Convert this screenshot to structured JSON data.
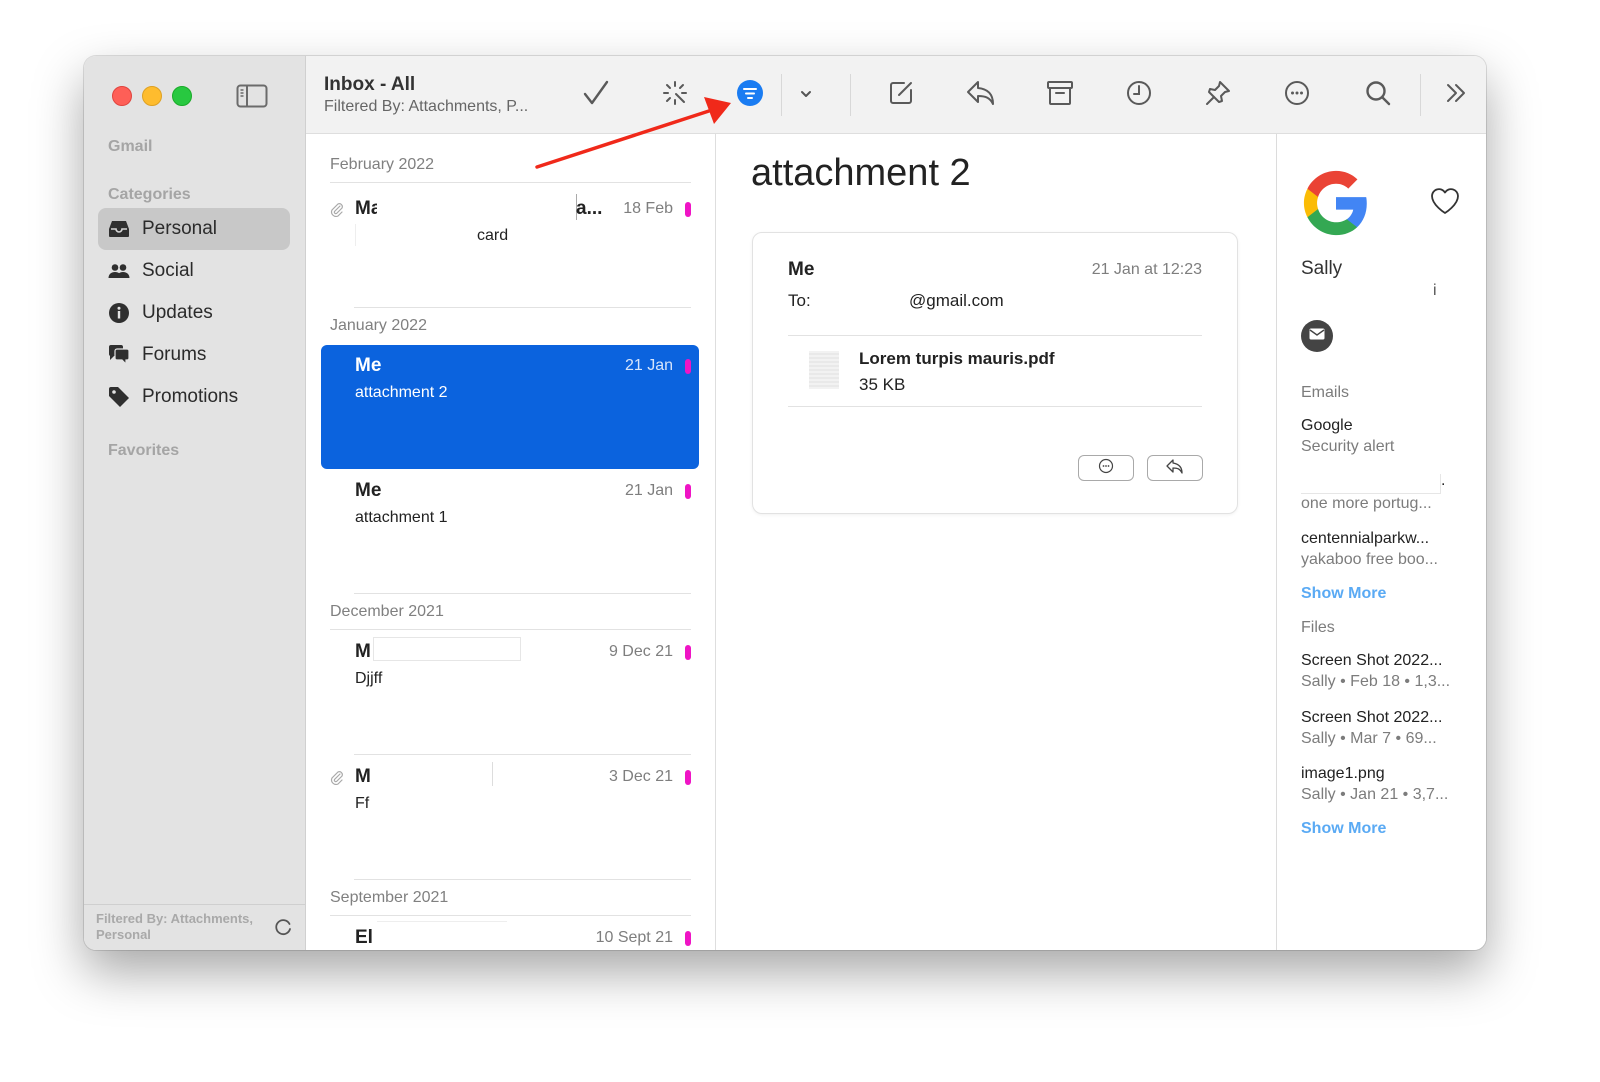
{
  "window": {
    "title": "Inbox - All",
    "subtitle": "Filtered By: Attachments, P..."
  },
  "sidebar": {
    "account": "Gmail",
    "categories_label": "Categories",
    "items": [
      {
        "label": "Personal",
        "icon": "tray-icon",
        "active": true
      },
      {
        "label": "Social",
        "icon": "people-icon",
        "active": false
      },
      {
        "label": "Updates",
        "icon": "info-icon",
        "active": false
      },
      {
        "label": "Forums",
        "icon": "chat-bubbles-icon",
        "active": false
      },
      {
        "label": "Promotions",
        "icon": "tag-icon",
        "active": false
      }
    ],
    "favorites_label": "Favorites",
    "footer_text": "Filtered By: Attachments, Personal"
  },
  "toolbar": {
    "buttons": [
      "checkmark-icon",
      "magic-wand-icon",
      "filter-icon",
      "chevron-down-icon",
      "compose-icon",
      "reply-icon",
      "archive-icon",
      "clock-icon",
      "pin-icon",
      "more-icon",
      "search-icon",
      "chevrons-right-icon"
    ],
    "filter_color": "#1a7cf2"
  },
  "list": {
    "groups": [
      {
        "month": "February 2022",
        "messages": [
          {
            "sender": "Ma",
            "sender_tail": "a...",
            "date": "18 Feb",
            "subject": "card",
            "attachment": true,
            "selected": false
          }
        ]
      },
      {
        "month": "January 2022",
        "messages": [
          {
            "sender": "Me",
            "date": "21 Jan",
            "subject": "attachment 2",
            "attachment": false,
            "selected": true
          },
          {
            "sender": "Me",
            "date": "21 Jan",
            "subject": "attachment 1",
            "attachment": false,
            "selected": false
          }
        ]
      },
      {
        "month": "December 2021",
        "messages": [
          {
            "sender": "M",
            "date": "9 Dec 21",
            "subject": "Djjff",
            "attachment": false,
            "selected": false
          },
          {
            "sender": "M",
            "date": "3 Dec 21",
            "subject": "Ff",
            "attachment": true,
            "selected": false
          }
        ]
      },
      {
        "month": "September 2021",
        "messages": [
          {
            "sender": "El",
            "date": "10 Sept 21",
            "subject": "",
            "attachment": false,
            "selected": false
          }
        ]
      }
    ],
    "flag_color": "#ef14c5",
    "selected_color": "#0b63de"
  },
  "reader": {
    "title": "attachment 2",
    "from": "Me",
    "timestamp": "21 Jan at 12:23",
    "to_label": "To:",
    "to_value": "@gmail.com",
    "attachment": {
      "name": "Lorem turpis mauris.pdf",
      "size": "35 KB"
    }
  },
  "contact": {
    "name": "Sally",
    "name_tail": "i",
    "emails_label": "Emails",
    "emails": [
      {
        "title": "Google",
        "subtitle": "Security alert"
      },
      {
        "title": ".",
        "subtitle": "one more portug..."
      },
      {
        "title": "centennialparkw...",
        "subtitle": "yakaboo free boo..."
      }
    ],
    "show_more_emails": "Show More",
    "files_label": "Files",
    "files": [
      {
        "title": "Screen Shot 2022...",
        "subtitle": "Sally • Feb 18 • 1,3..."
      },
      {
        "title": "Screen Shot 2022...",
        "subtitle": "Sally • Mar 7 • 69..."
      },
      {
        "title": "image1.png",
        "subtitle": "Sally • Jan 21 • 3,7..."
      }
    ],
    "show_more_files": "Show More",
    "link_color": "#5aaaf4"
  },
  "annotation": {
    "color": "#f0291a",
    "points_to": "filter-button"
  }
}
